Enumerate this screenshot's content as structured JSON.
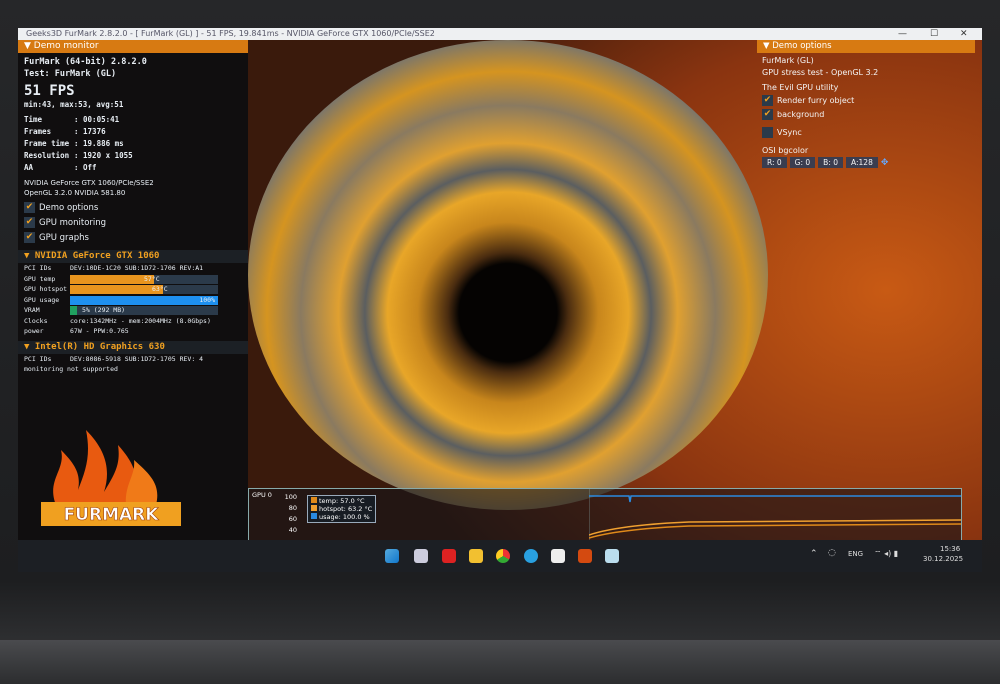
{
  "window": {
    "title": "Geeks3D FurMark 2.8.2.0 - [ FurMark (GL) ] - 51 FPS, 19.841ms - NVIDIA GeForce GTX 1060/PCIe/SSE2",
    "minimize": "—",
    "maximize": "☐",
    "close": "✕"
  },
  "monitor": {
    "header": "Demo monitor",
    "app": "FurMark (64-bit) 2.8.2.0",
    "test": "Test: FurMark (GL)",
    "fps": "51 FPS",
    "fps_stats": "min:43, max:53, avg:51",
    "stats": [
      {
        "k": "Time",
        "v": ": 00:05:41"
      },
      {
        "k": "Frames",
        "v": ": 17376"
      },
      {
        "k": "Frame time",
        "v": ": 19.886 ms"
      },
      {
        "k": "Resolution",
        "v": ": 1920 x 1055"
      },
      {
        "k": "AA",
        "v": ": Off"
      }
    ],
    "renderer": "NVIDIA GeForce GTX 1060/PCIe/SSE2",
    "opengl": "OpenGL 3.2.0 NVIDIA 581.80",
    "checks": [
      "Demo options",
      "GPU monitoring",
      "GPU graphs"
    ]
  },
  "gpu1": {
    "name": "NVIDIA GeForce GTX 1060",
    "pci_label": "PCI IDs",
    "pci": "DEV:10DE-1C20 SUB:1D72-1706 REV:A1",
    "temp_label": "GPU temp",
    "temp": "57°C",
    "temp_frac": 0.57,
    "hotspot_label": "GPU hotspot",
    "hotspot": "63°C",
    "hotspot_frac": 0.63,
    "usage_label": "GPU usage",
    "usage": "100%",
    "usage_frac": 1.0,
    "vram_label": "VRAM",
    "vram": "5% (292 MB)",
    "vram_frac": 0.05,
    "clocks_label": "Clocks",
    "clocks": "core:1342MHz - mem:2004MHz (8.0Gbps)",
    "power_label": "power",
    "power": "67W - PPW:0.765"
  },
  "gpu2": {
    "name": "Intel(R) HD Graphics 630",
    "pci_label": "PCI IDs",
    "pci": "DEV:8086-5918 SUB:1D72-1705 REV: 4",
    "note": "monitoring not supported"
  },
  "logo_text": "FURMARK",
  "options": {
    "header": "Demo options",
    "l1": "FurMark (GL)",
    "l2": "GPU stress test - OpenGL 3.2",
    "l3": "The Evil GPU utility",
    "render": "Render furry object",
    "background": "background",
    "vsync": "VSync",
    "bg_label": "OSI bgcolor",
    "r": "R: 0",
    "g": "G: 0",
    "b": "B: 0",
    "a": "A:128"
  },
  "graph": {
    "title": "GPU 0",
    "ticks": [
      "100",
      "80",
      "60",
      "40"
    ],
    "legend": [
      "temp: 57.0 °C",
      "hotspot: 63.2 °C",
      "usage: 100.0 %"
    ],
    "colors": {
      "temp": "#e08a1a",
      "hotspot": "#f0a030",
      "usage": "#2a8ae0"
    }
  },
  "tray": {
    "lang": "ENG",
    "time": "15:36",
    "date": "30.12.2025"
  }
}
